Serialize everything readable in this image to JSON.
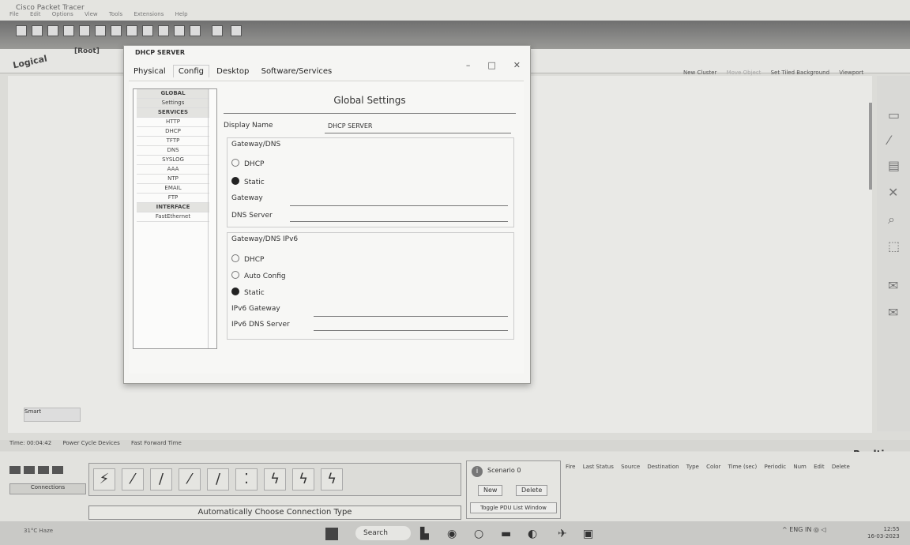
{
  "app": {
    "title": "Cisco Packet Tracer",
    "menus": [
      "File",
      "Edit",
      "Options",
      "View",
      "Tools",
      "Extensions",
      "Help"
    ],
    "logical_label": "Logical",
    "root_label": "[Root]",
    "top_actions": [
      "New Cluster",
      "Move Object",
      "Set Tiled Background",
      "Viewport"
    ],
    "status_items": [
      "Time: 00:04:42",
      "Power Cycle Devices",
      "Fast Forward Time"
    ],
    "realtime": "Realtime",
    "nav_label": "Smart",
    "auto_connection": "Automatically Choose Connection Type",
    "connections_label": "Connections",
    "scenario": {
      "selected": "Scenario 0",
      "new": "New",
      "delete": "Delete",
      "toggle": "Toggle PDU List Window"
    },
    "pdu_columns": [
      "Fire",
      "Last Status",
      "Source",
      "Destination",
      "Type",
      "Color",
      "Time (sec)",
      "Periodic",
      "Num",
      "Edit",
      "Delete"
    ]
  },
  "dialog": {
    "title": "DHCP SERVER",
    "tabs": [
      "Physical",
      "Config",
      "Desktop",
      "Software/Services"
    ],
    "active_tab": "Config",
    "left_list": [
      {
        "label": "GLOBAL",
        "header": true
      },
      {
        "label": "Settings",
        "selected": true
      },
      {
        "label": "SERVICES",
        "header": true
      },
      {
        "label": "HTTP"
      },
      {
        "label": "DHCP"
      },
      {
        "label": "TFTP"
      },
      {
        "label": "DNS"
      },
      {
        "label": "SYSLOG"
      },
      {
        "label": "AAA"
      },
      {
        "label": "NTP"
      },
      {
        "label": "EMAIL"
      },
      {
        "label": "FTP"
      },
      {
        "label": "INTERFACE",
        "header": true
      },
      {
        "label": "FastEthernet"
      }
    ],
    "global_settings": {
      "title": "Global Settings",
      "display_name_label": "Display Name",
      "display_name_value": "DHCP SERVER",
      "gateway_dns_title": "Gateway/DNS",
      "gw_options": [
        {
          "label": "DHCP",
          "selected": false
        },
        {
          "label": "Static",
          "selected": true
        }
      ],
      "gateway_label": "Gateway",
      "dns_server_label": "DNS Server",
      "gateway_dns_v6_title": "Gateway/DNS IPv6",
      "gw6_options": [
        {
          "label": "DHCP",
          "selected": false
        },
        {
          "label": "Auto Config",
          "selected": false
        },
        {
          "label": "Static",
          "selected": true
        }
      ],
      "ipv6_gateway_label": "IPv6 Gateway",
      "ipv6_dns_label": "IPv6 DNS Server"
    },
    "controls": [
      "–",
      "□",
      "✕"
    ]
  },
  "taskbar": {
    "weather": "31°C Haze",
    "search": "Search",
    "lang": "ENG IN",
    "time": "12:55",
    "date": "16-03-2023"
  }
}
